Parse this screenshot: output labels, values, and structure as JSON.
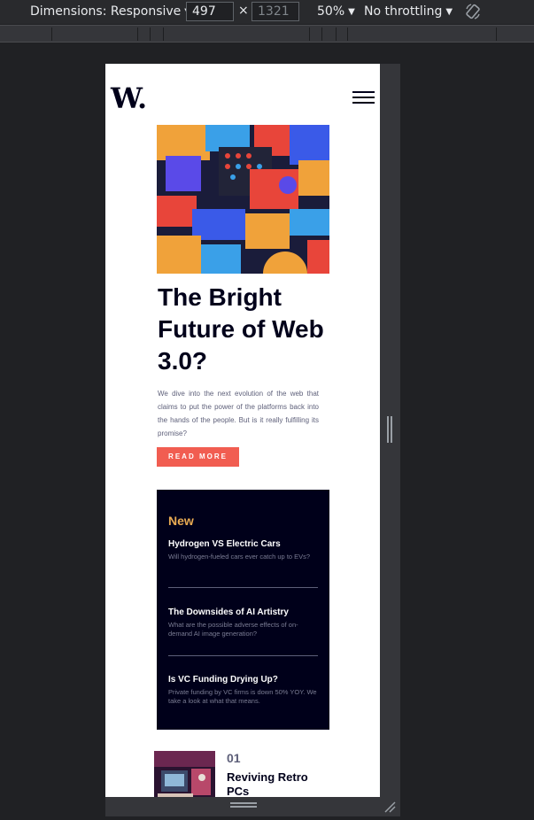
{
  "devtools": {
    "dimensions_label": "Dimensions: Responsive",
    "width_value": "497",
    "height_value": "1321",
    "times": "×",
    "zoom": "50%",
    "throttle": "No throttling"
  },
  "page": {
    "logo": "W.",
    "hero_title": "The Bright Future of Web 3.0?",
    "hero_desc": "We dive into the next evolution of the web that claims to put the power of the platforms back into the hands of the people. But is it really fulfilling its promise?",
    "read_more": "READ MORE",
    "new_heading": "New",
    "news": [
      {
        "title": "Hydrogen VS Electric Cars",
        "sub": "Will hydrogen-fueled cars ever catch up to EVs?"
      },
      {
        "title": "The Downsides of AI Artistry",
        "sub": "What are the possible adverse effects of on-demand AI image generation?"
      },
      {
        "title": "Is VC Funding Drying Up?",
        "sub": "Private funding by VC firms is down 50% YOY. We take a look at what that means."
      }
    ],
    "retro_num": "01",
    "retro_title": "Reviving Retro PCs"
  },
  "icons": {
    "menu": "hamburger-icon",
    "rotate": "rotate-icon",
    "caret": "caret-down-icon"
  },
  "colors": {
    "accent": "#f15d51",
    "new_gold": "#e9ab53",
    "dark": "#00001a"
  }
}
